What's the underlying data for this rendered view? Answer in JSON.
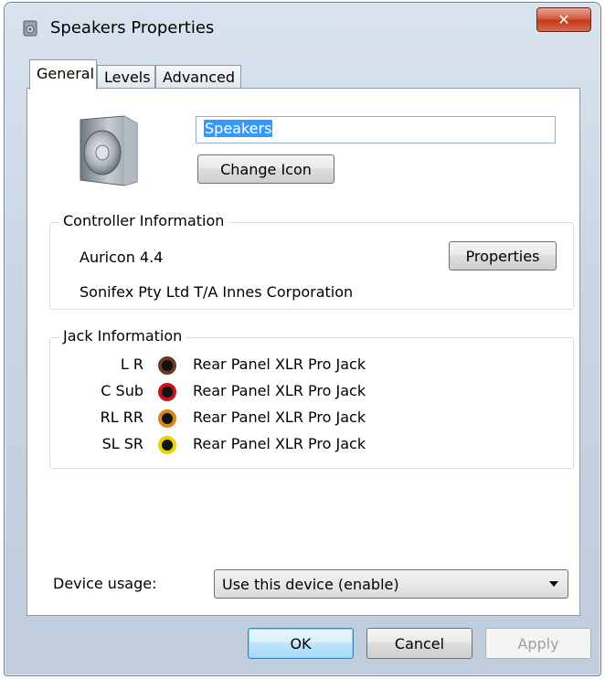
{
  "window": {
    "title": "Speakers Properties",
    "close_glyph": "✕"
  },
  "tabs": [
    {
      "label": "General",
      "active": true
    },
    {
      "label": "Levels",
      "active": false
    },
    {
      "label": "Advanced",
      "active": false
    }
  ],
  "device": {
    "name": "Speakers",
    "change_icon_label": "Change Icon"
  },
  "controller": {
    "legend": "Controller Information",
    "name": "Auricon 4.4",
    "vendor": "Sonifex Pty Ltd T/A Innes Corporation",
    "properties_label": "Properties"
  },
  "jacks": {
    "legend": "Jack Information",
    "items": [
      {
        "label": "L R",
        "text": "Rear Panel XLR Pro Jack",
        "color": "#6b3a1f"
      },
      {
        "label": "C Sub",
        "text": "Rear Panel XLR Pro Jack",
        "color": "#c0141e"
      },
      {
        "label": "RL RR",
        "text": "Rear Panel XLR Pro Jack",
        "color": "#d9861a"
      },
      {
        "label": "SL SR",
        "text": "Rear Panel XLR Pro Jack",
        "color": "#e5d400"
      }
    ]
  },
  "usage": {
    "label": "Device usage:",
    "selected": "Use this device (enable)"
  },
  "footer": {
    "ok_label": "OK",
    "cancel_label": "Cancel",
    "apply_label": "Apply"
  },
  "icons": {
    "app": "speaker-app-icon",
    "speaker": "speaker-icon",
    "close": "close-icon",
    "dropdown": "chevron-down-icon"
  }
}
